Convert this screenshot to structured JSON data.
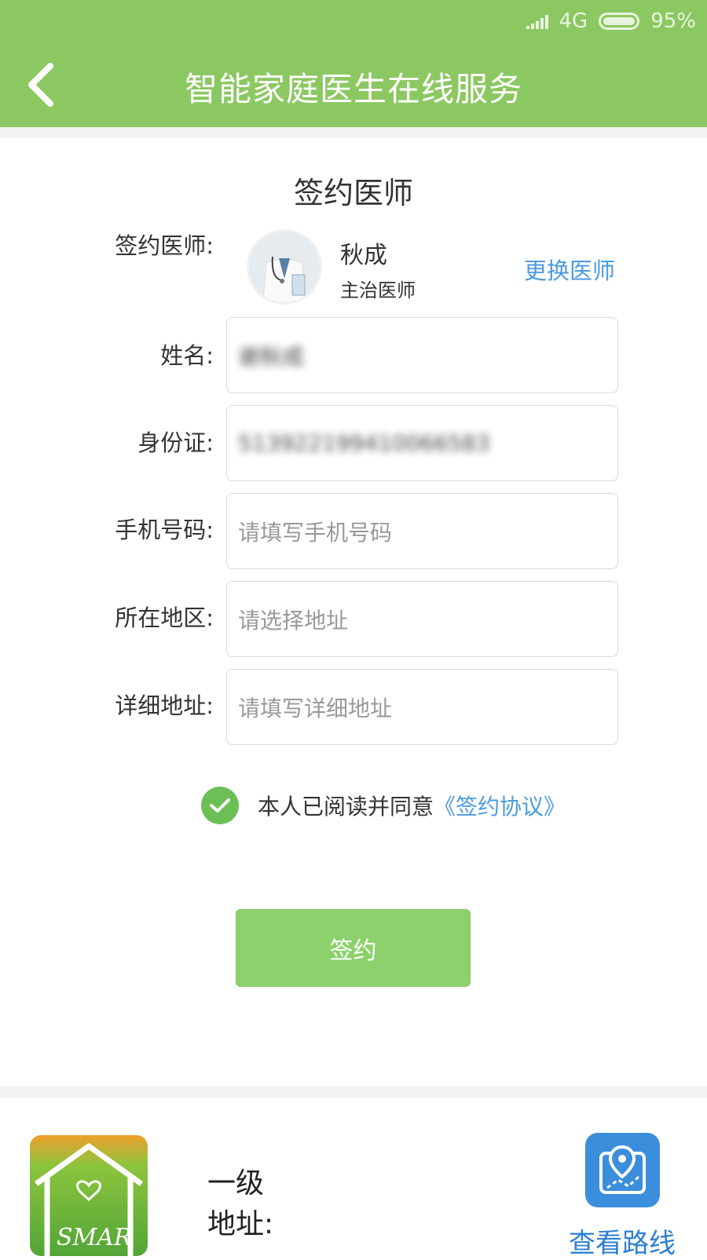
{
  "status_bar": {
    "network": "4G",
    "battery": "95%"
  },
  "header": {
    "title": "智能家庭医生在线服务"
  },
  "section_title": "签约医师",
  "doctor": {
    "label": "签约医师:",
    "name": "秋成",
    "rank": "主治医师",
    "change_label": "更换医师"
  },
  "form": {
    "name": {
      "label": "姓名:",
      "value": "谢秋成"
    },
    "id_card": {
      "label": "身份证:",
      "value": "513922199410066583"
    },
    "phone": {
      "label": "手机号码:",
      "placeholder": "请填写手机号码"
    },
    "region": {
      "label": "所在地区:",
      "placeholder": "请选择地址"
    },
    "detail_address": {
      "label": "详细地址:",
      "placeholder": "请填写详细地址"
    }
  },
  "agreement": {
    "checked": true,
    "text": "本人已阅读并同意",
    "link": "《签约协议》"
  },
  "sign_button": "签约",
  "footer": {
    "level": "一级",
    "address_label": "地址:",
    "route_label": "查看路线"
  },
  "colors": {
    "header": "#8cc862",
    "link": "#4a9be0",
    "button": "#8dd16c",
    "check": "#6cbf55",
    "route_icon": "#3a8edc"
  }
}
